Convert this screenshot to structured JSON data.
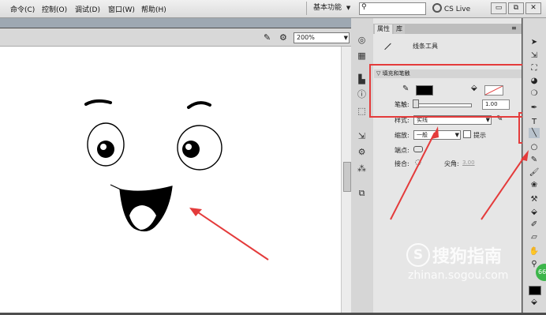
{
  "menu": [
    "命令(C)",
    "控制(O)",
    "调试(D)",
    "窗口(W)",
    "帮助(H)"
  ],
  "workspace": "基本功能",
  "search": {
    "placeholder": ""
  },
  "cslive": "CS Live",
  "zoom": "200%",
  "panel": {
    "tabs": [
      "属性",
      "库"
    ],
    "tool_name": "线条工具",
    "section": "填充和笔触",
    "stroke_label": "笔触:",
    "stroke_value": "1.00",
    "style_label": "样式:",
    "style_value": "实线",
    "scale_label": "缩放:",
    "scale_value": "一般",
    "hint_label": "提示",
    "cap_label": "端点:",
    "join_label": "接合:",
    "miter_label": "尖角:",
    "miter_value": "3.00"
  },
  "watermark": {
    "brand": "搜狗指南",
    "url": "zhinan.sogou.com"
  },
  "badge": "66",
  "colors": {
    "annotation": "#e43b3b",
    "stroke": "#000000",
    "fill": "#ffffff"
  }
}
